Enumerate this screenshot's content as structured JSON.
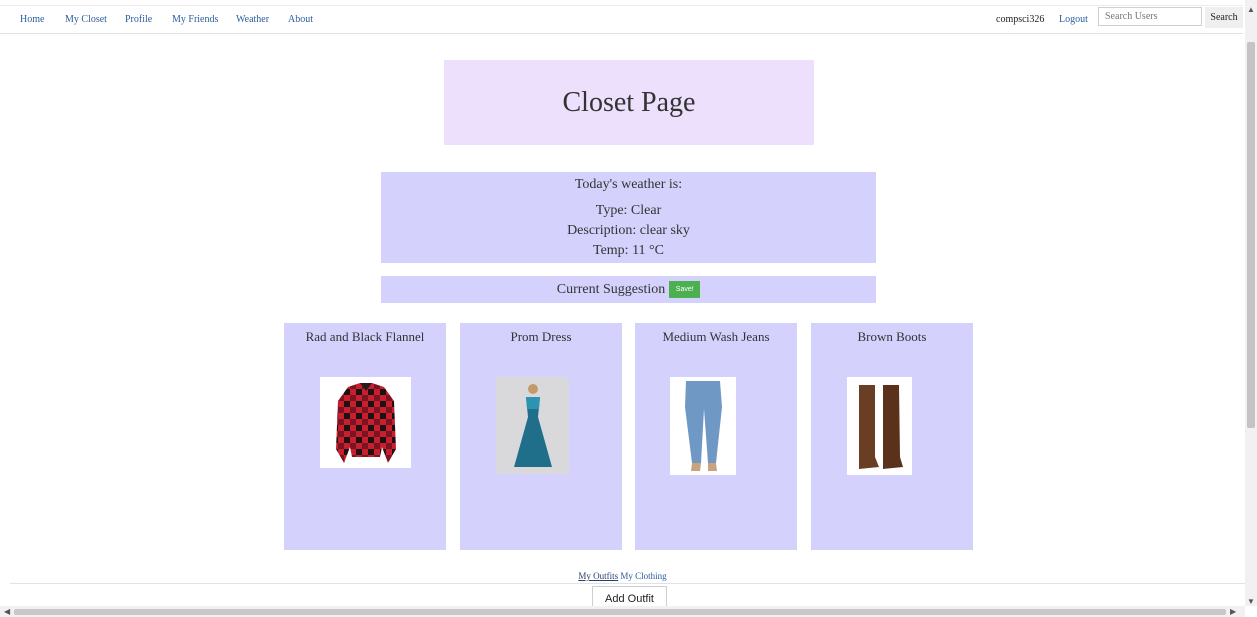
{
  "nav": {
    "items": [
      "Home",
      "My Closet",
      "Profile",
      "My Friends",
      "Weather",
      "About"
    ],
    "username": "compsci326",
    "logout": "Logout",
    "search_placeholder": "Search Users",
    "search_button": "Search"
  },
  "page_title": "Closet Page",
  "weather": {
    "heading": "Today's weather is:",
    "type": "Type: Clear",
    "description": "Description: clear sky",
    "temp": "Temp: 11 °C"
  },
  "suggestion": {
    "label": "Current Suggestion",
    "save_label": "Save!"
  },
  "items": [
    {
      "name": "Rad and Black Flannel",
      "icon": "flannel-shirt-image"
    },
    {
      "name": "Prom Dress",
      "icon": "prom-dress-image"
    },
    {
      "name": "Medium Wash Jeans",
      "icon": "jeans-image"
    },
    {
      "name": "Brown Boots",
      "icon": "boots-image"
    }
  ],
  "footer": {
    "link_outfits": "My Outfits",
    "link_clothing": "My Clothing",
    "add_outfit": "Add Outfit"
  },
  "colors": {
    "title_bg": "#ece0fc",
    "panel_bg": "#d4d2fc",
    "save_green": "#4caf50",
    "link_blue": "#2a5d9f"
  }
}
